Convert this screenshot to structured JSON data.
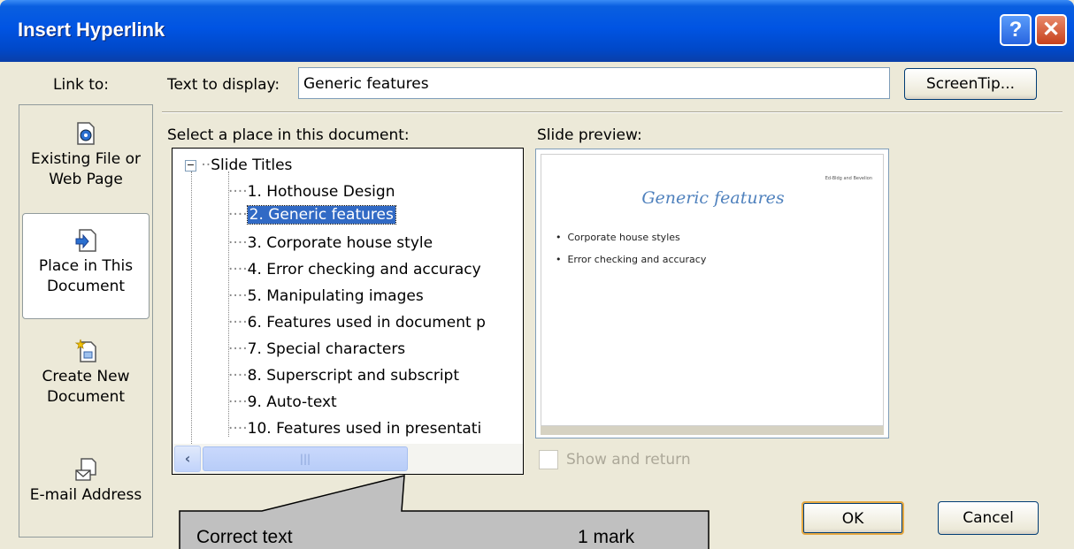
{
  "dialog": {
    "title": "Insert Hyperlink"
  },
  "link_to": {
    "label": "Link to:",
    "items": [
      {
        "line1": "Existing File or",
        "line2": "Web Page",
        "icon": "existing-file-icon"
      },
      {
        "line1": "Place in This",
        "line2": "Document",
        "icon": "place-in-document-icon",
        "selected": true
      },
      {
        "line1": "Create New",
        "line2": "Document",
        "icon": "create-new-document-icon"
      },
      {
        "line1": "E-mail Address",
        "line2": "",
        "icon": "email-icon"
      }
    ]
  },
  "text_to_display": {
    "label": "Text to display:",
    "value": "Generic features"
  },
  "screentip_button": "ScreenTip...",
  "select_place": {
    "label": "Select a place in this document:",
    "root": "Slide Titles",
    "items": [
      "1. Hothouse Design",
      "2. Generic features",
      "3. Corporate house style",
      "4. Error checking and accuracy",
      "5. Manipulating images",
      "6. Features used in document p",
      "7. Special characters",
      "8. Superscript and subscript",
      "9. Auto-text",
      "10. Features used in presentati"
    ],
    "selected_index": 1
  },
  "slide_preview": {
    "label": "Slide preview:",
    "header_text": "Ed-Bldg and Bevelion",
    "slide_title": "Generic features",
    "bullets": [
      "Corporate house styles",
      "Error checking and accuracy"
    ]
  },
  "show_and_return": {
    "label": "Show and return",
    "checked": false
  },
  "buttons": {
    "ok": "OK",
    "cancel": "Cancel"
  },
  "callout": {
    "text": "Correct text",
    "mark": "1 mark"
  },
  "colors": {
    "title_bar": "#0054e3",
    "dialog_bg": "#ece9d8",
    "selection": "#316ac5"
  }
}
